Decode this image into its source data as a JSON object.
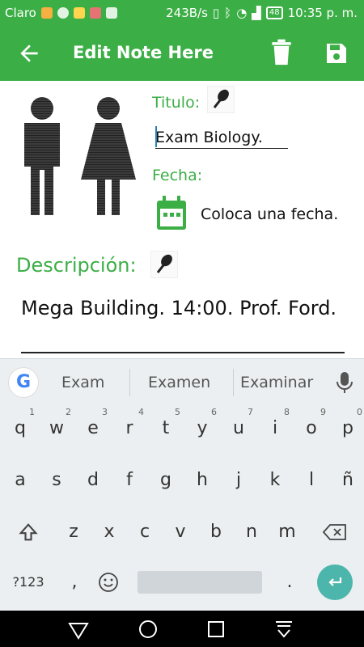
{
  "status_bar": {
    "carrier": "Claro",
    "net_speed": "243B/s",
    "battery": "48",
    "time": "10:35 p. m."
  },
  "appbar": {
    "title": "Edit Note Here",
    "back_icon": "arrow-left-icon",
    "delete_icon": "trash-icon",
    "save_icon": "floppy-disk-icon",
    "color": "#3cae46"
  },
  "form": {
    "titulo_label": "Titulo:",
    "titulo_value": "Exam Biology.",
    "fecha_label": "Fecha:",
    "fecha_value": "Coloca una fecha.",
    "descripcion_label": "Descripción:",
    "descripcion_value": "Mega Building. 14:00. Prof. Ford."
  },
  "keyboard": {
    "suggestions": [
      "Exam",
      "Examen",
      "Examinar"
    ],
    "row1": [
      {
        "k": "q",
        "h": "1"
      },
      {
        "k": "w",
        "h": "2"
      },
      {
        "k": "e",
        "h": "3"
      },
      {
        "k": "r",
        "h": "4"
      },
      {
        "k": "t",
        "h": "5"
      },
      {
        "k": "y",
        "h": "6"
      },
      {
        "k": "u",
        "h": "7"
      },
      {
        "k": "i",
        "h": "8"
      },
      {
        "k": "o",
        "h": "9"
      },
      {
        "k": "p",
        "h": "0"
      }
    ],
    "row2": [
      "a",
      "s",
      "d",
      "f",
      "g",
      "h",
      "j",
      "k",
      "l",
      "ñ"
    ],
    "row3": [
      "z",
      "x",
      "c",
      "v",
      "b",
      "n",
      "m"
    ],
    "symbols_label": "?123",
    "comma": ",",
    "period": "."
  }
}
